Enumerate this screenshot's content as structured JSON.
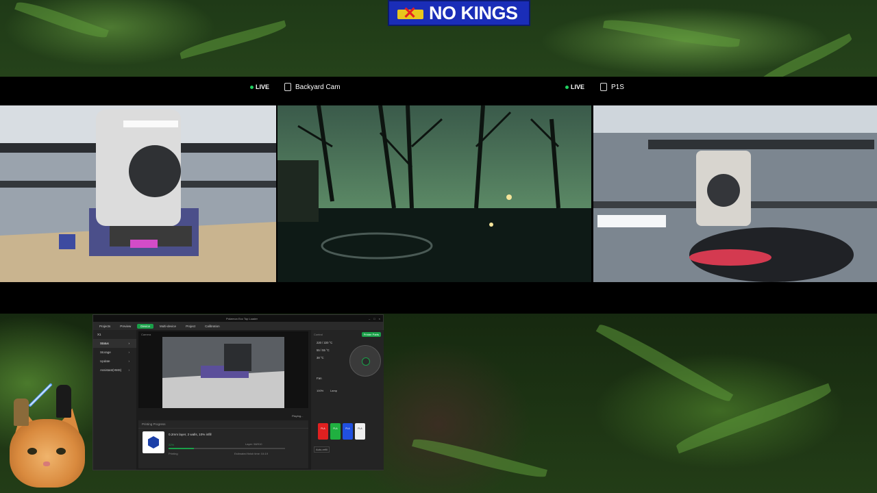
{
  "banner": {
    "text": "NO KINGS"
  },
  "cams": [
    {
      "title": "",
      "live": "LIVE"
    },
    {
      "title": "Backyard Cam",
      "live": "LIVE"
    },
    {
      "title": "P1S",
      "live": ""
    }
  ],
  "app": {
    "window_title": "Pokemon Eco Top Loader",
    "printer": "X1",
    "tabs": [
      "Projects",
      "Preview",
      "Device",
      "Multi-device",
      "Project",
      "Calibration"
    ],
    "active_tab": "Device",
    "sidebar": [
      "Status",
      "Storage",
      "Update",
      "Assistant(HMS)"
    ],
    "camera_label": "Camera",
    "playing": "Playing...",
    "progress": {
      "title": "Printing Progress",
      "desc": "0.2mm layer, 2 walls, 10% infill",
      "percent_text": "22%",
      "percent": 22,
      "status": "Printing",
      "layer": "Layer: 58/910",
      "eta": "Estimated finish time: 04:19"
    },
    "control": {
      "label": "Control",
      "parts": "Printer Parts",
      "nozzle": "220 / 220 °C",
      "bed": "55 / 55 °C",
      "chamber": "38 °C",
      "fan": "Fan",
      "speed": "100%",
      "lamp": "Lamp",
      "spools": [
        {
          "label": "PLA",
          "color": "#e02020"
        },
        {
          "label": "PLA",
          "color": "#20b040"
        },
        {
          "label": "PLA",
          "color": "#2050e0"
        },
        {
          "label": "PLA",
          "color": "#eeeeee"
        }
      ],
      "auto": "Auto-refill"
    }
  }
}
